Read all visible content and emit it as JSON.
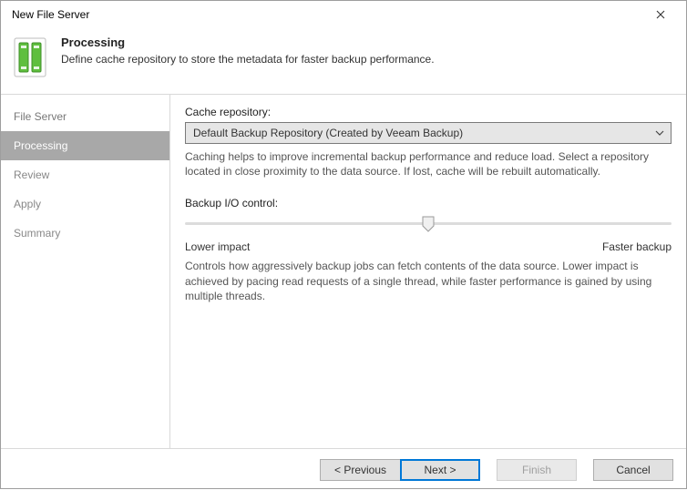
{
  "window": {
    "title": "New File Server"
  },
  "header": {
    "title": "Processing",
    "description": "Define cache repository to store the metadata for faster backup performance."
  },
  "sidebar": {
    "items": [
      {
        "label": "File Server",
        "state": "past"
      },
      {
        "label": "Processing",
        "state": "active"
      },
      {
        "label": "Review",
        "state": "future"
      },
      {
        "label": "Apply",
        "state": "future"
      },
      {
        "label": "Summary",
        "state": "future"
      }
    ]
  },
  "main": {
    "cache_label": "Cache repository:",
    "cache_value": "Default Backup Repository (Created by Veeam Backup)",
    "cache_help": "Caching helps to improve incremental backup performance and reduce load. Select a repository located in close proximity to the data source. If lost, cache will be rebuilt automatically.",
    "io_label": "Backup I/O control:",
    "io_low": "Lower impact",
    "io_high": "Faster backup",
    "io_help": "Controls how aggressively backup jobs can fetch contents of the data source. Lower impact is achieved by pacing read requests of a single thread, while faster performance is gained by using multiple threads."
  },
  "footer": {
    "previous": "< Previous",
    "next": "Next >",
    "finish": "Finish",
    "cancel": "Cancel"
  }
}
